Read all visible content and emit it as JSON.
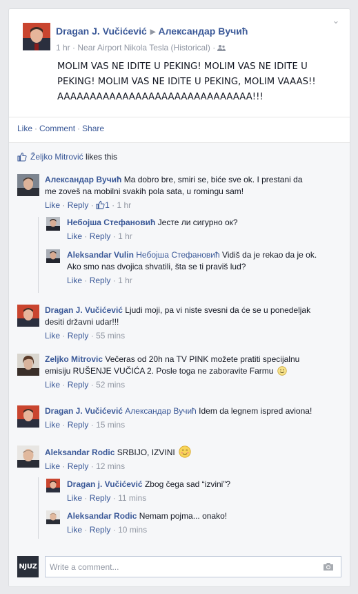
{
  "post": {
    "author": "Dragan J. Vučićević",
    "target": "Александар Вучић",
    "time": "1 hr",
    "location_sep": "·",
    "location": "Near Airport Nikola Tesla (Historical)",
    "location_sep2": "·",
    "body": "MOLIM VAS NE IDITE U PEKING! MOLIM VAS NE IDITE U PEKING! MOLIM VAS NE IDITE U PEKING, MOLIM VAAAS!! AAAAAAAAAAAAAAAAAAAAAAAAAAAAAA!!!"
  },
  "actions": {
    "like": "Like",
    "comment": "Comment",
    "share": "Share",
    "sep": "·"
  },
  "likes": {
    "who": "Željko Mitrović",
    "text": " likes this"
  },
  "comments": [
    {
      "author": "Александар Вучић",
      "text_line1": " Ma dobro bre, smiri se, biće sve ok. I prestani da",
      "text_line2": "me zoveš na mobilni svakih pola sata, u romingu sam!",
      "like": "Like",
      "reply": "Reply",
      "sep": "·",
      "likes_count": "1",
      "time": "1 hr"
    },
    {
      "author": "Небојша Стефановић",
      "text": " Јесте ли сигурно ок?",
      "like": "Like",
      "reply": "Reply",
      "sep": "·",
      "time": "1 hr"
    },
    {
      "author": "Aleksandar Vulin",
      "mention": "Небојша Стефановић",
      "text_line1": " Vidiš da je rekao da je ok.",
      "text_line2": "Ako smo nas dvojica shvatili, šta se ti praviš lud?",
      "like": "Like",
      "reply": "Reply",
      "sep": "·",
      "time": "1 hr"
    },
    {
      "author": "Dragan J. Vučićević",
      "text_line1": " Ljudi moji, pa vi niste svesni da će se u ponedeljak",
      "text_line2": "desiti državni udar!!!",
      "like": "Like",
      "reply": "Reply",
      "sep": "·",
      "time": "55 mins"
    },
    {
      "author": "Zeljko Mitrovic",
      "text_line1": " Večeras od 20h na TV PINK možete pratiti specijalnu",
      "text_line2": "emisiju RUŠENJE VUČIĆA 2. Posle toga ne zaboravite Farmu",
      "like": "Like",
      "reply": "Reply",
      "sep": "·",
      "time": "52 mins"
    },
    {
      "author": "Dragan J. Vučićević",
      "mention": "Александар Вучић",
      "text": " Idem da legnem ispred aviona!",
      "like": "Like",
      "reply": "Reply",
      "sep": "·",
      "time": "15 mins"
    },
    {
      "author": "Aleksandar Rodic",
      "text": " SRBIJO, IZVINI",
      "like": "Like",
      "reply": "Reply",
      "sep": "·",
      "time": "12 mins"
    },
    {
      "author": "Dragan j. Vučićević",
      "text": " Zbog čega sad “izvini”?",
      "like": "Like",
      "reply": "Reply",
      "sep": "·",
      "time": "11 mins"
    },
    {
      "author": "Aleksandar Rodic",
      "text": " Nemam pojma... onako!",
      "like": "Like",
      "reply": "Reply",
      "sep": "·",
      "time": "10 mins"
    }
  ],
  "composer": {
    "placeholder": "Write a comment...",
    "logo_text": "NJUZ"
  },
  "icons": {
    "menu": "chevron-down-icon",
    "audience": "friends-icon",
    "like": "thumbs-up-icon",
    "camera": "camera-icon",
    "smile": "smiley-icon",
    "blush": "blush-icon"
  },
  "colors": {
    "link": "#3b5998",
    "meta": "#9197a3",
    "background": "#e9eaed"
  }
}
